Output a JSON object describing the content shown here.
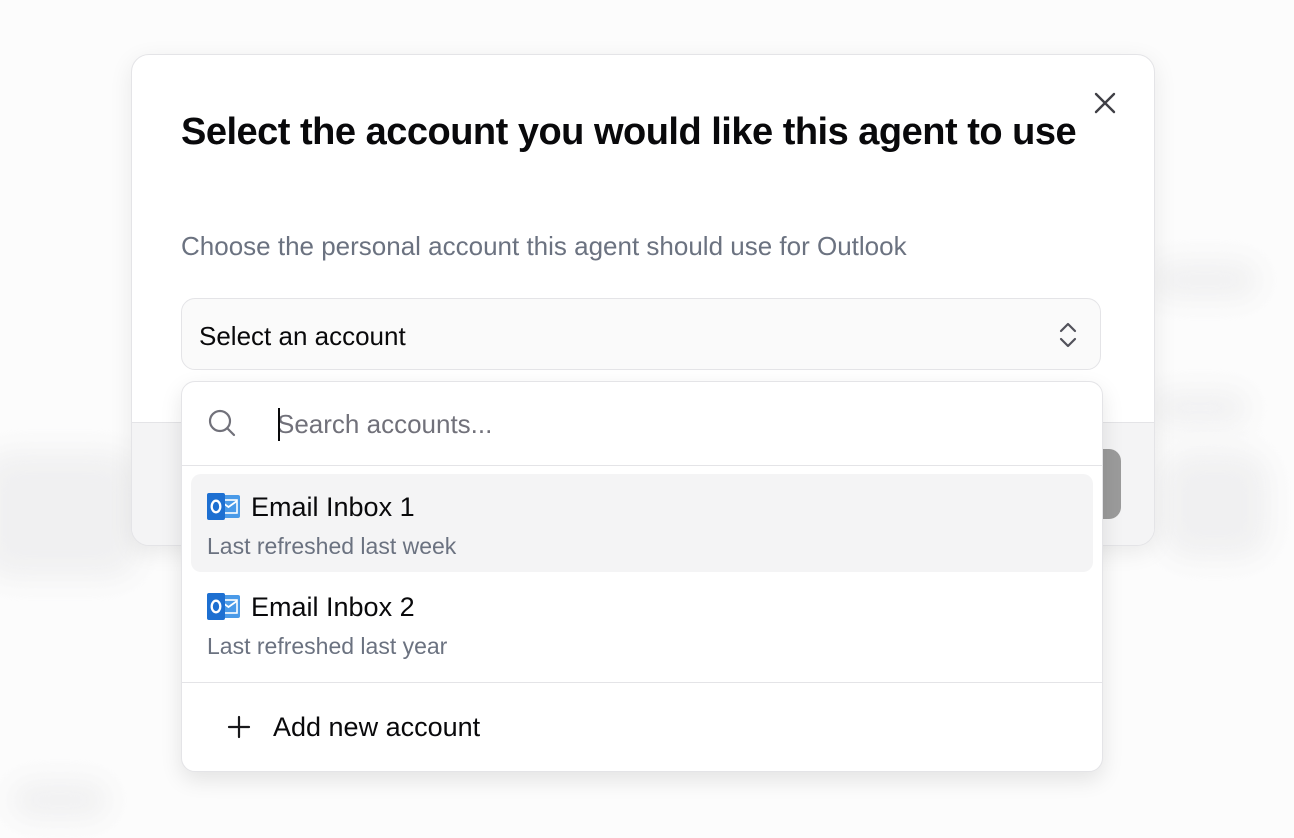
{
  "dialog": {
    "title": "Select the account you would like this agent to use",
    "subtitle": "Choose the personal account this agent should use for Outlook",
    "close_icon": "close-icon"
  },
  "account_select": {
    "value": "Select an account",
    "icon": "chevron-up-down-icon"
  },
  "account_dropdown": {
    "search": {
      "placeholder": "Search accounts...",
      "value": "",
      "icon": "search-icon"
    },
    "options": [
      {
        "name": "Email Inbox 1",
        "last_refreshed": "Last refreshed last week",
        "icon": "outlook-icon",
        "highlighted": true
      },
      {
        "name": "Email Inbox 2",
        "last_refreshed": "Last refreshed last year",
        "icon": "outlook-icon",
        "highlighted": false
      }
    ],
    "add_new": {
      "label": "Add new account",
      "icon": "plus-icon"
    }
  },
  "colors": {
    "outlook_blue": "#2b7cd3",
    "outlook_dark": "#1a5fb4",
    "text_primary": "#09090b",
    "text_muted": "#6b7280",
    "border": "#e4e4e7",
    "highlight": "#f4f4f5"
  }
}
